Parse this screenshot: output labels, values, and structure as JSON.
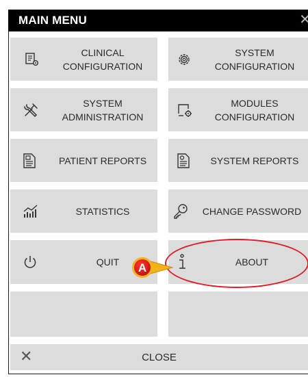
{
  "header": {
    "title": "MAIN MENU",
    "close_glyph": "✕"
  },
  "tiles": [
    {
      "icon": "clinical-config-icon",
      "label": "CLINICAL CONFIGURATION"
    },
    {
      "icon": "system-config-gear-icon",
      "label": "SYSTEM CONFIGURATION"
    },
    {
      "icon": "wrench-screwdriver-icon",
      "label": "SYSTEM ADMINISTRATION"
    },
    {
      "icon": "modules-config-icon",
      "label": "MODULES CONFIGURATION"
    },
    {
      "icon": "patient-report-icon",
      "label": "PATIENT REPORTS"
    },
    {
      "icon": "system-report-icon",
      "label": "SYSTEM REPORTS"
    },
    {
      "icon": "statistics-chart-icon",
      "label": "STATISTICS"
    },
    {
      "icon": "key-icon",
      "label": "CHANGE PASSWORD"
    },
    {
      "icon": "power-icon",
      "label": "QUIT"
    },
    {
      "icon": "info-icon",
      "label": "ABOUT"
    }
  ],
  "close": {
    "label": "CLOSE",
    "glyph": "✕"
  },
  "annotation": {
    "marker": "A",
    "color": "#e01b24"
  }
}
